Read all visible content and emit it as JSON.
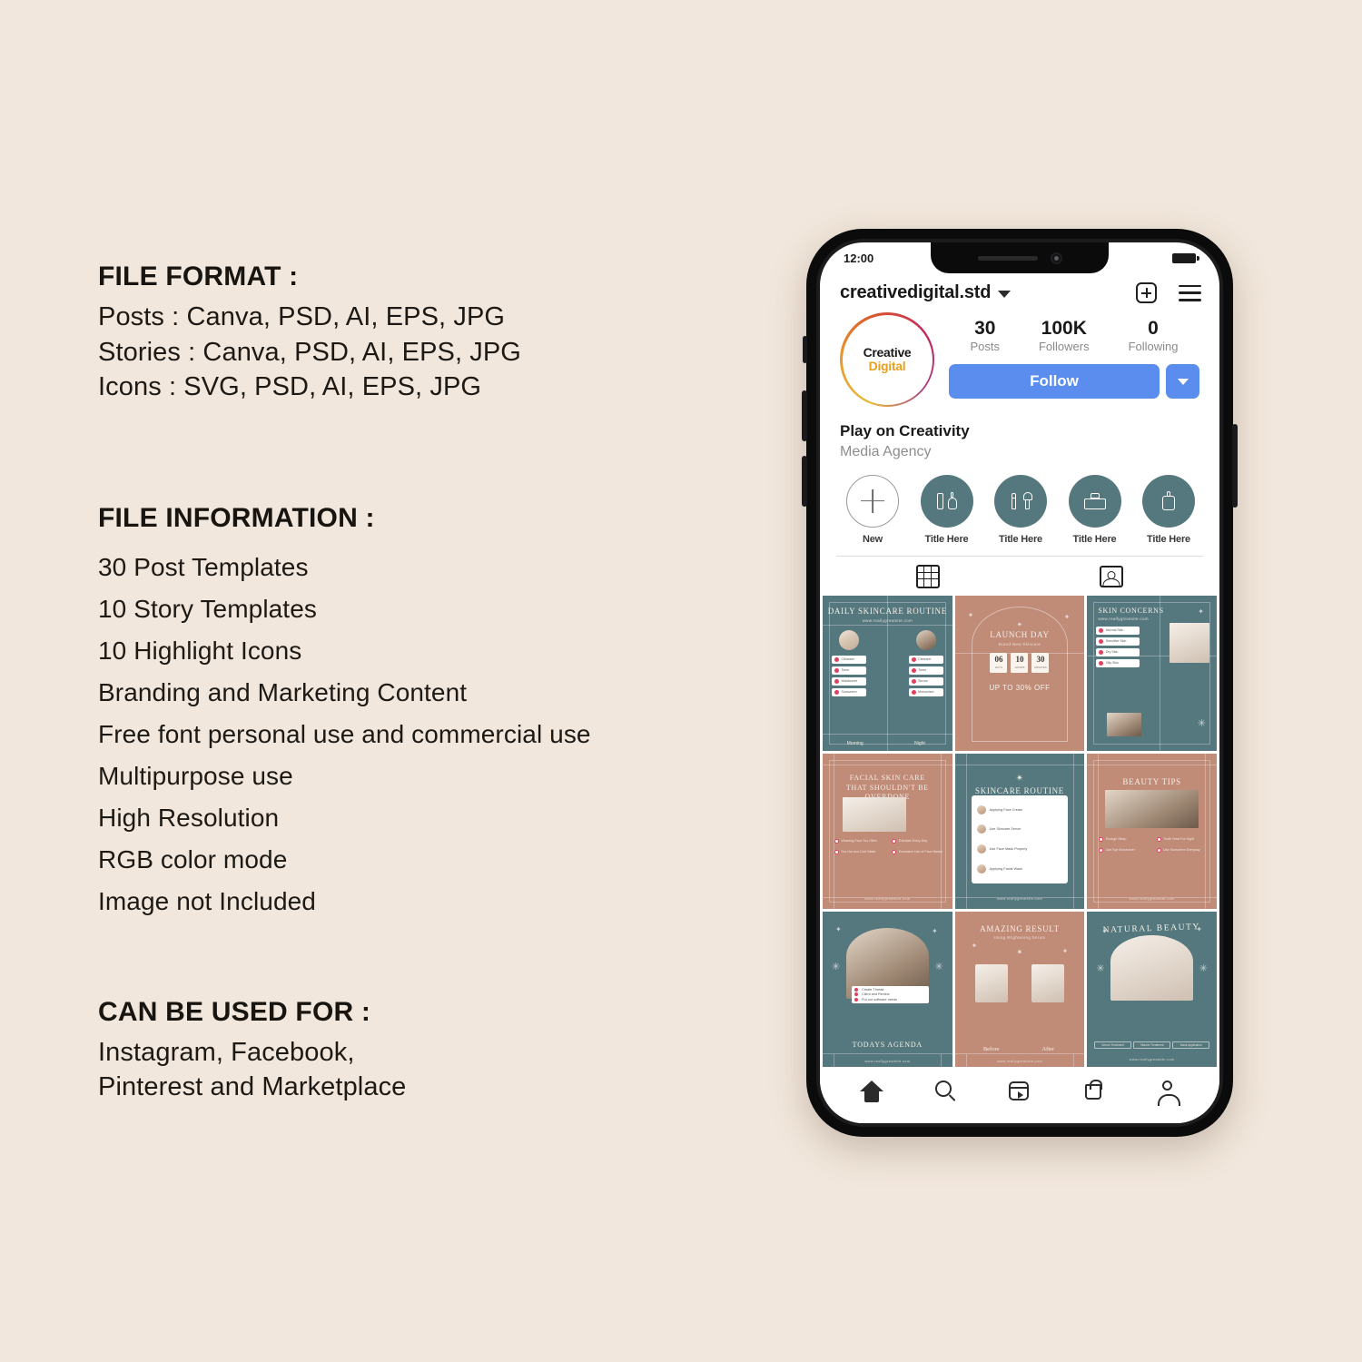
{
  "theme": {
    "background": "#F2E7DC",
    "teal": "#55787E",
    "terracotta": "#C08B77",
    "follow_blue": "#5B8DEF",
    "accent_gold": "#E8A020",
    "text_dark": "#1D1A16"
  },
  "left_panel": {
    "file_format": {
      "heading": "FILE FORMAT :",
      "lines": [
        "Posts : Canva, PSD, AI, EPS, JPG",
        "Stories : Canva, PSD, AI, EPS, JPG",
        "Icons : SVG, PSD, AI, EPS, JPG"
      ]
    },
    "file_information": {
      "heading": "FILE INFORMATION :",
      "items": [
        "30 Post Templates",
        "10 Story Templates",
        "10 Highlight Icons",
        "Branding and Marketing Content",
        "Free font personal use and commercial use",
        "Multipurpose use",
        "High Resolution",
        "RGB color mode",
        "Image not Included"
      ]
    },
    "can_be_used_for": {
      "heading": "CAN BE USED FOR :",
      "lines": [
        "Instagram, Facebook,",
        "Pinterest and Marketplace"
      ]
    }
  },
  "phone": {
    "status_bar": {
      "time": "12:00"
    },
    "header": {
      "username": "creativedigital.std",
      "chevron_icon": "chevron-down-icon",
      "add_icon": "plus-box-icon",
      "menu_icon": "hamburger-menu-icon"
    },
    "profile": {
      "avatar_line1": "Creative",
      "avatar_line2": "Digital",
      "stats": [
        {
          "value": "30",
          "label": "Posts"
        },
        {
          "value": "100K",
          "label": "Followers"
        },
        {
          "value": "0",
          "label": "Following"
        }
      ],
      "follow_label": "Follow",
      "bio_name": "Play on Creativity",
      "bio_sub": "Media Agency"
    },
    "highlights": [
      {
        "label": "New",
        "icon": "plus-icon"
      },
      {
        "label": "Title Here",
        "icon": "nail-polish-icon"
      },
      {
        "label": "Title Here",
        "icon": "makeup-brush-icon"
      },
      {
        "label": "Title Here",
        "icon": "vanity-case-icon"
      },
      {
        "label": "Title Here",
        "icon": "lotion-bottle-icon"
      }
    ],
    "tabs": [
      {
        "name": "grid-tab",
        "icon": "grid-icon"
      },
      {
        "name": "tagged-tab",
        "icon": "tagged-person-icon"
      }
    ],
    "posts": [
      {
        "id": "daily-skincare-routine",
        "color": "teal",
        "title": "DAILY SKINCARE ROUTINE",
        "subtitle": "www.reallygreatsite.com",
        "columns": [
          {
            "label": "Morning",
            "chips": [
              "Cleanser",
              "Toner",
              "Moisturizer",
              "Sunscreen"
            ]
          },
          {
            "label": "Night",
            "chips": [
              "Cleanser",
              "Toner",
              "Serum",
              "Moisturizer"
            ]
          }
        ]
      },
      {
        "id": "launch-day",
        "color": "terracotta",
        "title": "LAUNCH DAY",
        "subtitle": "Brand New Skincare",
        "countdown": [
          {
            "value": "06",
            "unit": "DAYS"
          },
          {
            "value": "10",
            "unit": "HOURS"
          },
          {
            "value": "30",
            "unit": "MINUTES"
          }
        ],
        "offer": "UP TO 30% OFF"
      },
      {
        "id": "skin-concerns",
        "color": "teal",
        "title": "SKIN CONCERNS",
        "subtitle": "www.reallygreatsite.com",
        "chips": [
          "Normal Skin",
          "Sensitive Skin",
          "Dry Skin",
          "Oily Skin"
        ]
      },
      {
        "id": "facial-skin-care",
        "color": "terracotta",
        "title_line1": "FACIAL SKIN CARE",
        "title_line2": "THAT SHOULDN'T BE OVERDONE",
        "chips": [
          "Washing Face Too Often",
          "Exfoliate Every Day",
          "Too Hot and Cold Water",
          "Excessive Use of Face Masks"
        ],
        "footer": "www.reallygreatsite.com"
      },
      {
        "id": "skincare-routine",
        "color": "teal",
        "title": "SKINCARE ROUTINE",
        "list": [
          "Applying Face Cream",
          "Use Skincare Serum",
          "Use Face Mask Properly",
          "Applying Facial Wash"
        ],
        "footer": "www.reallygreatsite.com"
      },
      {
        "id": "beauty-tips",
        "color": "terracotta",
        "title": "BEAUTY TIPS",
        "chips": [
          "Enough Sleep",
          "Tooth Treat For Night",
          "Use Eye Moisturizer",
          "Use Sunscreen Everyday"
        ],
        "footer": "www.reallygreatsite.com"
      },
      {
        "id": "todays-agenda",
        "color": "teal",
        "title": "TODAYS AGENDA",
        "chips": [
          "Create Thread",
          "Client and Review",
          "Put our software needs"
        ],
        "footer": "www.reallygreatsite.com"
      },
      {
        "id": "amazing-result",
        "color": "terracotta",
        "title": "AMAZING RESULT",
        "subtitle": "Using Brightening Serum",
        "before_label": "Before",
        "after_label": "After",
        "footer": "www.reallygreatsite.com"
      },
      {
        "id": "natural-beauty",
        "color": "teal",
        "title": "NATURAL BEAUTY",
        "pills": [
          "Serum Treatment",
          "Vitamin Treatment",
          "Mask Application"
        ],
        "footer": "www.reallygreatsite.com"
      }
    ],
    "bottom_nav": [
      {
        "name": "home",
        "icon": "home-icon"
      },
      {
        "name": "search",
        "icon": "search-icon"
      },
      {
        "name": "reels",
        "icon": "reels-icon"
      },
      {
        "name": "shop",
        "icon": "shop-bag-icon"
      },
      {
        "name": "profile",
        "icon": "person-icon"
      }
    ]
  }
}
